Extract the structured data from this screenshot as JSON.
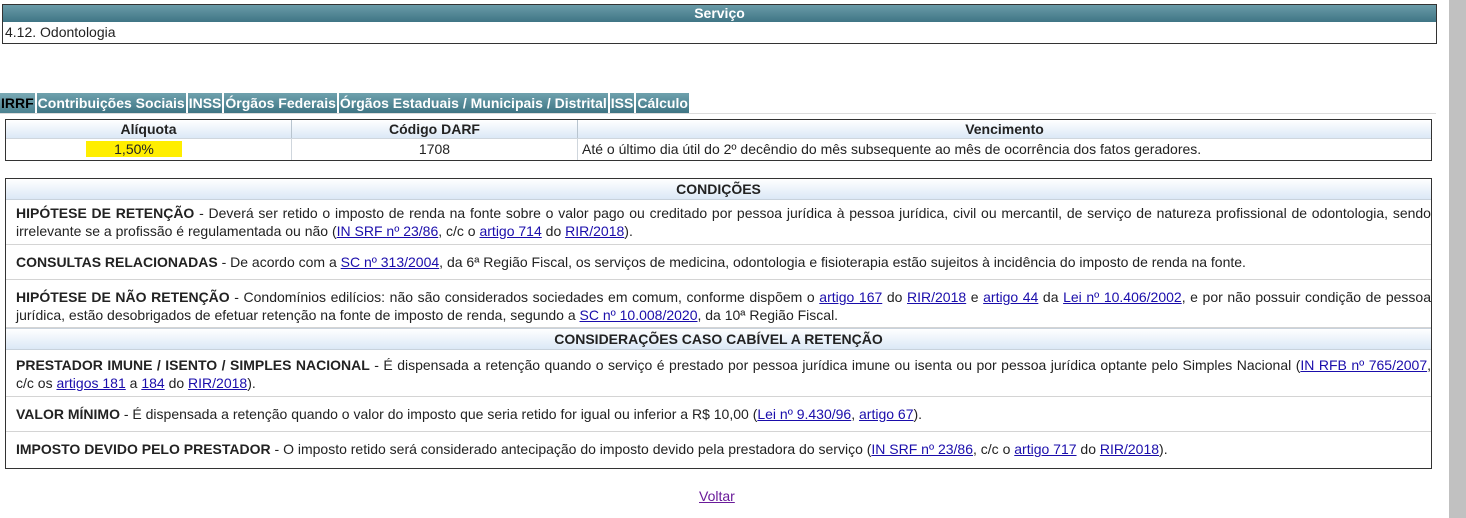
{
  "servico": {
    "header": "Serviço",
    "value": "4.12. Odontologia"
  },
  "tabs": [
    {
      "label": "IRRF"
    },
    {
      "label": "Contribuições Sociais"
    },
    {
      "label": "INSS"
    },
    {
      "label": "Órgãos Federais"
    },
    {
      "label": "Órgãos Estaduais / Municipais / Distrital"
    },
    {
      "label": "ISS"
    },
    {
      "label": "Cálculo"
    }
  ],
  "aliquota_table": {
    "headers": [
      "Alíquota",
      "Código DARF",
      "Vencimento"
    ],
    "row": {
      "aliquota": "1,50%",
      "codigo_darf": "1708",
      "vencimento": "Até o último dia útil do 2º decêndio do mês subsequente ao mês de ocorrência dos fatos geradores."
    },
    "highlight_color": "#ffee00"
  },
  "condicoes": {
    "header": "CONDIÇÕES",
    "hipotese_retencao": {
      "title": "HIPÓTESE DE RETENÇÃO",
      "text": " - Deverá ser retido o imposto de renda na fonte sobre o valor pago ou creditado por pessoa jurídica à pessoa jurídica, civil ou mercantil, de serviço de natureza profissional de odontologia, sendo irrelevante se a profissão é regulamentada ou não (",
      "link1": "IN SRF nº 23/86",
      "t2": ", c/c o ",
      "link2": "artigo 714",
      "t3": " do ",
      "link3": "RIR/2018",
      "t4": ")."
    },
    "consultas": {
      "title": "CONSULTAS RELACIONADAS",
      "t1": " - De acordo com a ",
      "link1": "SC nº 313/2004",
      "t2": ", da 6ª Região Fiscal, os serviços de medicina, odontologia e fisioterapia estão sujeitos à incidência do imposto de renda na fonte."
    },
    "hipotese_nao_retencao": {
      "title": "HIPÓTESE DE NÃO RETENÇÃO",
      "t1": " - Condomínios edilícios: não são considerados sociedades em comum, conforme dispõem o ",
      "link1": "artigo 167",
      "t2": " do ",
      "link2": "RIR/2018",
      "t3": " e ",
      "link3": "artigo 44",
      "t4": " da ",
      "link4": "Lei nº 10.406/2002",
      "t5": ", e por não possuir condição de pessoa jurídica, estão desobrigados de efetuar retenção na fonte de imposto de renda, segundo a ",
      "link5": "SC nº 10.008/2020",
      "t6": ", da 10ª Região Fiscal."
    }
  },
  "consideracoes": {
    "header": "CONSIDERAÇÕES CASO CABÍVEL A RETENÇÃO",
    "prestador_imune": {
      "title": "PRESTADOR IMUNE / ISENTO / SIMPLES NACIONAL",
      "t1": " - É dispensada a retenção quando o serviço é prestado por pessoa jurídica imune ou isenta ou por pessoa jurídica optante pelo Simples Nacional (",
      "link1": "IN RFB nº 765/2007",
      "t2": ", c/c os ",
      "link2": "artigos 181",
      "t3": " a ",
      "link3": "184",
      "t4": " do ",
      "link4": "RIR/2018",
      "t5": ")."
    },
    "valor_minimo": {
      "title": "VALOR MÍNIMO",
      "t1": " - É dispensada a retenção quando o valor do imposto que seria retido for igual ou inferior a R$ 10,00 (",
      "link1": "Lei nº 9.430/96",
      "t2": ", ",
      "link2": "artigo 67",
      "t3": ")."
    },
    "imposto_devido": {
      "title": "IMPOSTO DEVIDO PELO PRESTADOR",
      "t1": " - O imposto retido será considerado antecipação do imposto devido pela prestadora do serviço (",
      "link1": "IN SRF nº 23/86",
      "t2": ", c/c o ",
      "link2": "artigo 717",
      "t3": " do ",
      "link3": "RIR/2018",
      "t4": ")."
    }
  },
  "voltar": "Voltar"
}
